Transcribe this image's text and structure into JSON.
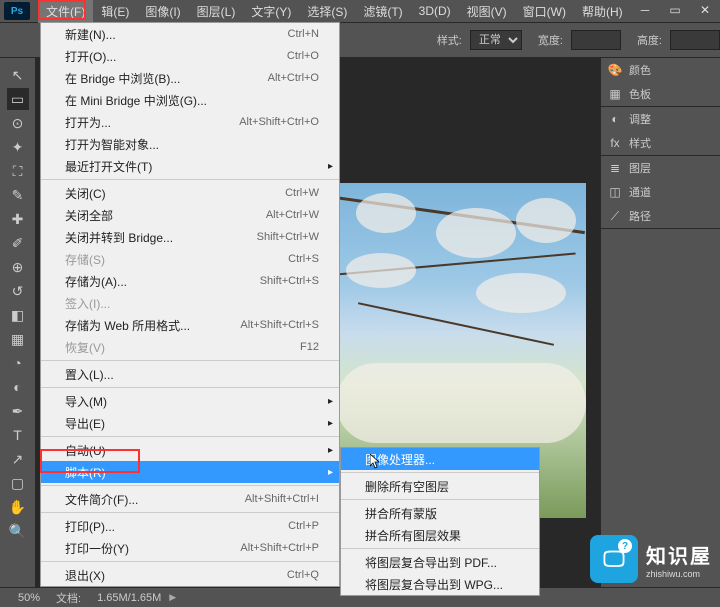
{
  "app": {
    "logo": "Ps"
  },
  "menubar": [
    "文件(F)",
    "辑(E)",
    "图像(I)",
    "图层(L)",
    "文字(Y)",
    "选择(S)",
    "滤镜(T)",
    "3D(D)",
    "视图(V)",
    "窗口(W)",
    "帮助(H)"
  ],
  "options": {
    "style_label": "样式:",
    "style_value": "正常",
    "width_label": "宽度:",
    "height_label": "高度:"
  },
  "dropdown": [
    {
      "t": "item",
      "label": "新建(N)...",
      "sc": "Ctrl+N"
    },
    {
      "t": "item",
      "label": "打开(O)...",
      "sc": "Ctrl+O"
    },
    {
      "t": "item",
      "label": "在 Bridge 中浏览(B)...",
      "sc": "Alt+Ctrl+O"
    },
    {
      "t": "item",
      "label": "在 Mini Bridge 中浏览(G)..."
    },
    {
      "t": "item",
      "label": "打开为...",
      "sc": "Alt+Shift+Ctrl+O"
    },
    {
      "t": "item",
      "label": "打开为智能对象..."
    },
    {
      "t": "item",
      "label": "最近打开文件(T)",
      "sub": true
    },
    {
      "t": "sep"
    },
    {
      "t": "item",
      "label": "关闭(C)",
      "sc": "Ctrl+W"
    },
    {
      "t": "item",
      "label": "关闭全部",
      "sc": "Alt+Ctrl+W"
    },
    {
      "t": "item",
      "label": "关闭并转到 Bridge...",
      "sc": "Shift+Ctrl+W"
    },
    {
      "t": "item",
      "label": "存储(S)",
      "sc": "Ctrl+S",
      "disabled": true
    },
    {
      "t": "item",
      "label": "存储为(A)...",
      "sc": "Shift+Ctrl+S"
    },
    {
      "t": "item",
      "label": "签入(I)...",
      "disabled": true
    },
    {
      "t": "item",
      "label": "存储为 Web 所用格式...",
      "sc": "Alt+Shift+Ctrl+S"
    },
    {
      "t": "item",
      "label": "恢复(V)",
      "sc": "F12",
      "disabled": true
    },
    {
      "t": "sep"
    },
    {
      "t": "item",
      "label": "置入(L)..."
    },
    {
      "t": "sep"
    },
    {
      "t": "item",
      "label": "导入(M)",
      "sub": true
    },
    {
      "t": "item",
      "label": "导出(E)",
      "sub": true
    },
    {
      "t": "sep"
    },
    {
      "t": "item",
      "label": "自动(U)",
      "sub": true
    },
    {
      "t": "item",
      "label": "脚本(R)",
      "sub": true,
      "hover": true
    },
    {
      "t": "sep"
    },
    {
      "t": "item",
      "label": "文件简介(F)...",
      "sc": "Alt+Shift+Ctrl+I"
    },
    {
      "t": "sep"
    },
    {
      "t": "item",
      "label": "打印(P)...",
      "sc": "Ctrl+P"
    },
    {
      "t": "item",
      "label": "打印一份(Y)",
      "sc": "Alt+Shift+Ctrl+P"
    },
    {
      "t": "sep"
    },
    {
      "t": "item",
      "label": "退出(X)",
      "sc": "Ctrl+Q"
    }
  ],
  "submenu": [
    {
      "t": "item",
      "label": "图像处理器...",
      "hover": true
    },
    {
      "t": "sep"
    },
    {
      "t": "item",
      "label": "删除所有空图层"
    },
    {
      "t": "sep"
    },
    {
      "t": "item",
      "label": "拼合所有蒙版"
    },
    {
      "t": "item",
      "label": "拼合所有图层效果"
    },
    {
      "t": "sep"
    },
    {
      "t": "item",
      "label": "将图层复合导出到 PDF..."
    },
    {
      "t": "item",
      "label": "将图层复合导出到 WPG..."
    }
  ],
  "panels": {
    "color": "颜色",
    "swatches": "色板",
    "adjust": "调整",
    "styles": "样式",
    "layers": "图层",
    "channels": "通道",
    "paths": "路径"
  },
  "status": {
    "zoom": "50%",
    "doc_label": "文档:",
    "doc_value": "1.65M/1.65M"
  },
  "badge": {
    "title": "知识屋",
    "url": "zhishiwu.com"
  }
}
